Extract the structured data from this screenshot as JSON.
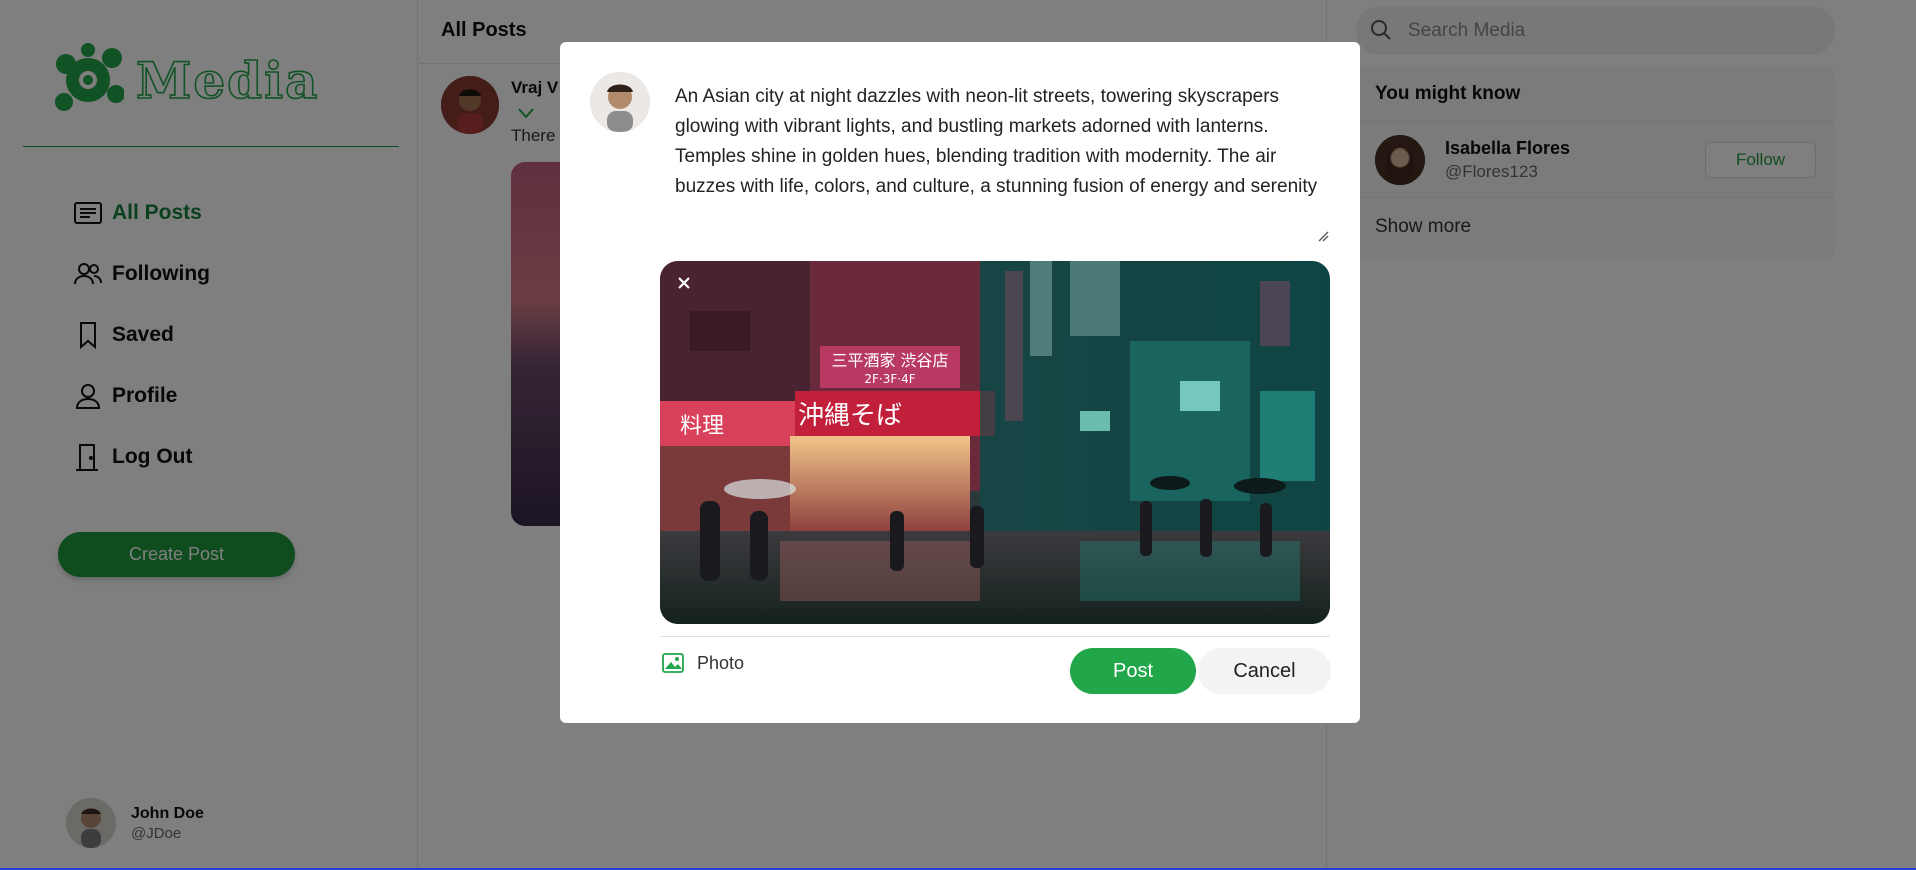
{
  "brand": {
    "name": "Media",
    "accent": "#22a64a"
  },
  "nav": {
    "items": [
      {
        "label": "All Posts",
        "icon": "news-icon",
        "active": true
      },
      {
        "label": "Following",
        "icon": "people-icon"
      },
      {
        "label": "Saved",
        "icon": "bookmark-icon"
      },
      {
        "label": "Profile",
        "icon": "person-icon"
      },
      {
        "label": "Log Out",
        "icon": "door-icon"
      }
    ],
    "create_label": "Create Post"
  },
  "current_user": {
    "name": "John Doe",
    "handle": "@JDoe"
  },
  "feed": {
    "title": "All Posts",
    "post": {
      "author": "Vraj V",
      "text": "There"
    }
  },
  "search": {
    "placeholder": "Search Media"
  },
  "suggestions": {
    "title": "You might know",
    "people": [
      {
        "name": "Isabella Flores",
        "handle": "@Flores123",
        "action": "Follow"
      }
    ],
    "show_more": "Show more"
  },
  "modal": {
    "post_text": "An Asian city at night dazzles with neon-lit streets, towering skyscrapers glowing with vibrant lights, and bustling markets adorned with lanterns. Temples shine in golden hues, blending tradition with modernity. The air buzzes with life, colors, and culture, a stunning fusion of energy and serenity",
    "photo_label": "Photo",
    "post_label": "Post",
    "cancel_label": "Cancel",
    "image_signs": [
      "三平酒家 渋谷店",
      "2F·3F·4F",
      "沖縄そば",
      "料理"
    ]
  }
}
